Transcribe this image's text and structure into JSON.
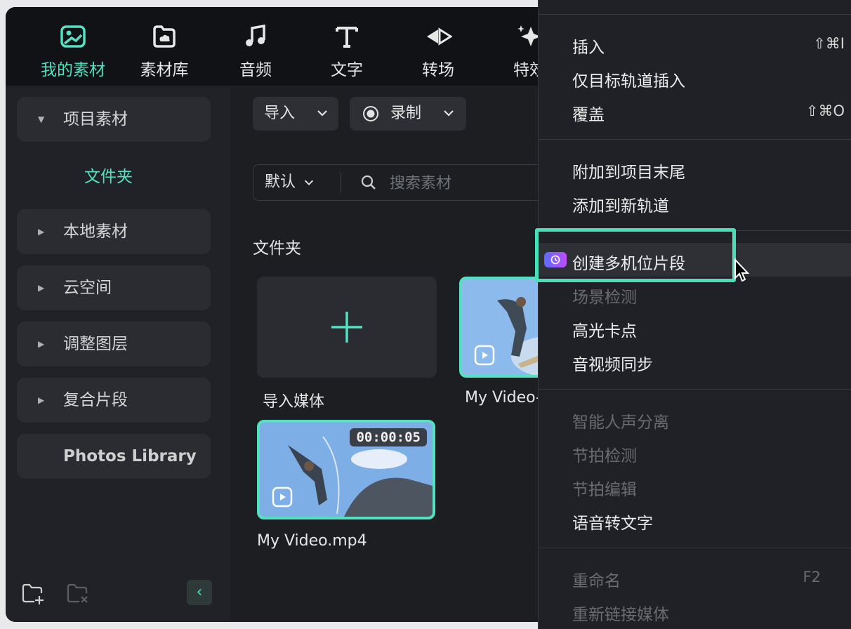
{
  "tabs": [
    {
      "label": "我的素材",
      "icon": "media-icon",
      "active": true
    },
    {
      "label": "素材库",
      "icon": "cloud-library-icon",
      "active": false
    },
    {
      "label": "音频",
      "icon": "music-note-icon",
      "active": false
    },
    {
      "label": "文字",
      "icon": "text-t-icon",
      "active": false
    },
    {
      "label": "转场",
      "icon": "transition-icon",
      "active": false
    },
    {
      "label": "特效",
      "icon": "sparkle-effects-icon",
      "active": false
    }
  ],
  "sidebar": {
    "items": [
      {
        "label": "项目素材",
        "expanded": true
      },
      {
        "label": "本地素材",
        "expanded": false
      },
      {
        "label": "云空间",
        "expanded": false
      },
      {
        "label": "调整图层",
        "expanded": false
      },
      {
        "label": "复合片段",
        "expanded": false
      },
      {
        "label": "Photos Library"
      }
    ],
    "subfolder": "文件夹",
    "collapse_glyph": "‹"
  },
  "toolbar": {
    "import_label": "导入",
    "record_label": "录制"
  },
  "search": {
    "sort_label": "默认",
    "placeholder": "搜索素材"
  },
  "media": {
    "section_title": "文件夹",
    "import_tile_label": "导入媒体",
    "clips": [
      {
        "name": "My Video-",
        "duration": ""
      },
      {
        "name": "My Video.mp4",
        "duration": "00:00:05"
      }
    ]
  },
  "menu": {
    "group1": [
      {
        "label": "插入",
        "shortcut": "⇧⌘I"
      },
      {
        "label": "仅目标轨道插入",
        "shortcut": ""
      },
      {
        "label": "覆盖",
        "shortcut": "⇧⌘O"
      }
    ],
    "group2": [
      {
        "label": "附加到项目末尾"
      },
      {
        "label": "添加到新轨道"
      }
    ],
    "group3": [
      {
        "label": "创建多机位片段",
        "disabled": false,
        "highlighted": true
      },
      {
        "label": "场景检测",
        "disabled": true
      },
      {
        "label": "高光卡点",
        "disabled": false
      },
      {
        "label": "音视频同步",
        "disabled": false
      }
    ],
    "group4": [
      {
        "label": "智能人声分离",
        "disabled": true
      },
      {
        "label": "节拍检测",
        "disabled": true
      },
      {
        "label": "节拍编辑",
        "disabled": true
      },
      {
        "label": "语音转文字",
        "disabled": false
      }
    ],
    "group5": [
      {
        "label": "重命名",
        "shortcut": "F2",
        "disabled": true
      },
      {
        "label": "重新链接媒体",
        "disabled": true
      }
    ]
  },
  "colors": {
    "accent": "#54e0c1",
    "highlight_border": "#49dfb9"
  }
}
